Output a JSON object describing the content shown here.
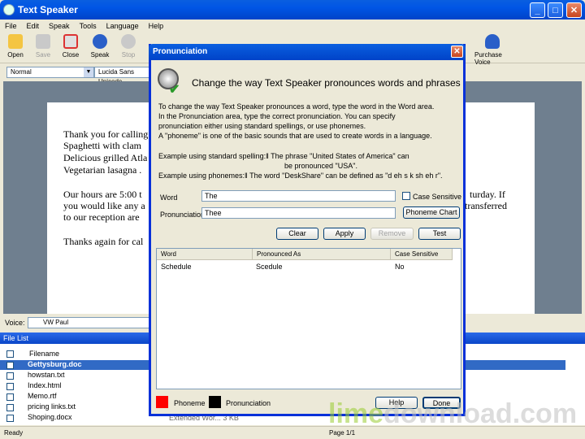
{
  "app": {
    "title": "Text Speaker",
    "min": "_",
    "max": "□",
    "close": "✕"
  },
  "menu": [
    "File",
    "Edit",
    "Speak",
    "Tools",
    "Language",
    "Help"
  ],
  "toolbar": {
    "open": "Open",
    "save": "Save",
    "close": "Close",
    "speak": "Speak",
    "stop": "Stop",
    "purchase": "Purchase Voice"
  },
  "format": {
    "style": "Normal",
    "font": "Lucida Sans Unicode"
  },
  "document": {
    "lines": [
      "Thank you for calling",
      "Spaghetti with clam",
      "Delicious grilled Atla",
      "Vegetarian lasagna .",
      "Our hours are 5:00 t",
      "you would like any a",
      "to our reception are",
      "Thanks again for cal"
    ],
    "right_lines": [
      "turday.  If",
      "transferred"
    ]
  },
  "voice": {
    "label": "Voice:",
    "value": "VW Paul"
  },
  "filelist": {
    "title": "File List",
    "col": "Filename",
    "files": [
      "Gettysburg.doc",
      "howstan.txt",
      "Index.html",
      "Memo.rtf",
      "pricing links.txt",
      "Shoping.docx"
    ],
    "partial": "Extended Wor...   3 KB"
  },
  "status": {
    "left": "Ready",
    "page": "Page 1/1"
  },
  "dialog": {
    "title": "Pronunciation",
    "heading": "Change the way Text Speaker pronounces words and phrases",
    "intro": [
      "To change the way Text Speaker pronounces a word, type the word in the Word area.",
      "In the Pronunciation area, type the correct pronunciation. You can specify",
      "pronunciation either using standard spellings, or use phonemes.",
      "A \"phoneme\" is one of the basic sounds that are used to create words in a language."
    ],
    "example1a": "Example using standard spelling:‖ The phrase \"United States of America\" can",
    "example1b": "be pronounced \"USA\".",
    "example2": "Example using phonemes:‖ The word \"DeskShare\" can be defined as \"d eh s k sh eh r\".",
    "word_label": "Word",
    "word_value": "The",
    "pron_label": "Pronunciation",
    "pron_value": "Thee",
    "case_label": "Case Sensitive",
    "phoneme_chart": "Phoneme Chart",
    "clear": "Clear",
    "apply": "Apply",
    "remove": "Remove",
    "test": "Test",
    "cols": [
      "Word",
      "Pronounced As",
      "Case Sensitive"
    ],
    "rows": [
      [
        "Schedule",
        "Scedule",
        "No"
      ]
    ],
    "legend_phoneme": "Phoneme",
    "legend_pron": "Pronunciation",
    "help": "Help",
    "done": "Done",
    "colors": {
      "phoneme": "#ff0000",
      "pronunciation": "#000000"
    }
  },
  "watermark": {
    "a": "lime",
    "b": "download",
    ".": ".com"
  }
}
